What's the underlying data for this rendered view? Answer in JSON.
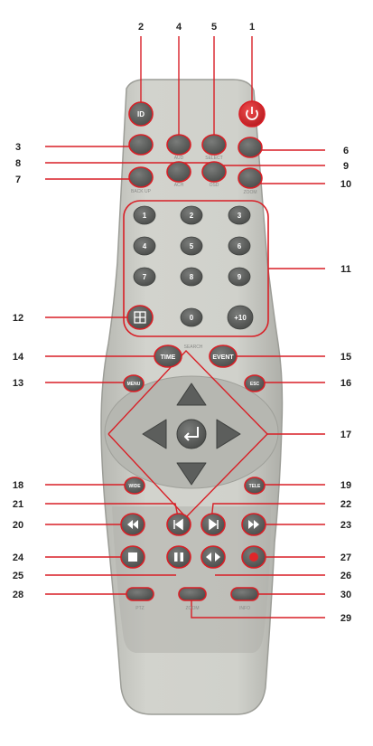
{
  "remote": {
    "colors": {
      "body": "#c9cac4",
      "button": "#5c5e5c",
      "power": "#d6282c",
      "callout": "#d81f26"
    },
    "top_buttons": {
      "id": "ID",
      "power_icon": "power-icon"
    },
    "sub_labels": {
      "audio": "AUD",
      "select": "SELECT",
      "backup": "BACK UP",
      "ach": "ACH",
      "osd": "OSD",
      "zoom": "ZOOM",
      "ptz": "PTZ",
      "zoom2": "ZOOM",
      "info": "INFO"
    },
    "numpad": [
      "1",
      "2",
      "3",
      "4",
      "5",
      "6",
      "7",
      "8",
      "9",
      "0",
      "+10"
    ],
    "time": "TIME",
    "event": "EVENT",
    "search": "SEARCH",
    "menu": "MENU",
    "esc": "ESC",
    "wide": "WIDE",
    "tele": "TELE"
  },
  "callouts": [
    "1",
    "2",
    "3",
    "4",
    "5",
    "6",
    "7",
    "8",
    "9",
    "10",
    "11",
    "12",
    "13",
    "14",
    "15",
    "16",
    "17",
    "18",
    "19",
    "20",
    "21",
    "22",
    "23",
    "24",
    "25",
    "26",
    "27",
    "28",
    "29",
    "30"
  ]
}
